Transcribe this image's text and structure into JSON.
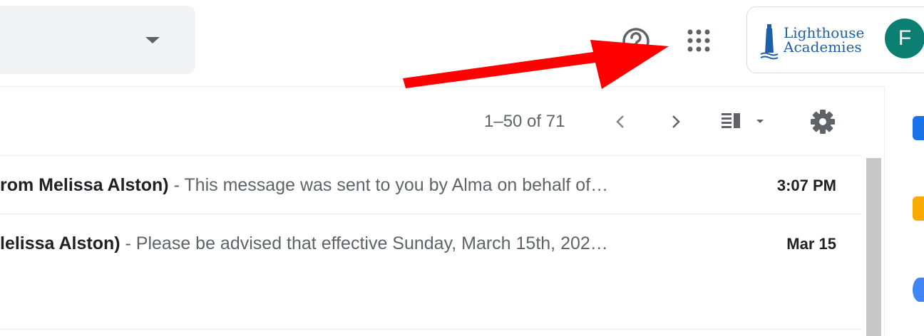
{
  "pagination": {
    "range_text": "1–50 of 71"
  },
  "account": {
    "logo_line1": "Lighthouse",
    "logo_line2": "Academies",
    "avatar_initial": "F"
  },
  "emails": [
    {
      "sender": "rom Melissa Alston)",
      "snippet": " - This message was sent to you by Alma on behalf of…",
      "date": "3:07 PM"
    },
    {
      "sender": "lelissa Alston)",
      "snippet": " - Please be advised that effective Sunday, March 15th, 202…",
      "date": "Mar 15"
    }
  ],
  "icons": {
    "help": "help-icon",
    "apps": "apps-grid-icon",
    "prev": "chevron-left-icon",
    "next": "chevron-right-icon",
    "layout": "split-pane-icon",
    "settings": "gear-icon"
  },
  "colors": {
    "arrow": "#ff0000",
    "avatar": "#0b8072",
    "logo": "#1f5fa8",
    "side_calendar": "#1a73e8",
    "side_keep": "#f9ab00",
    "side_tasks": "#4285f4"
  }
}
